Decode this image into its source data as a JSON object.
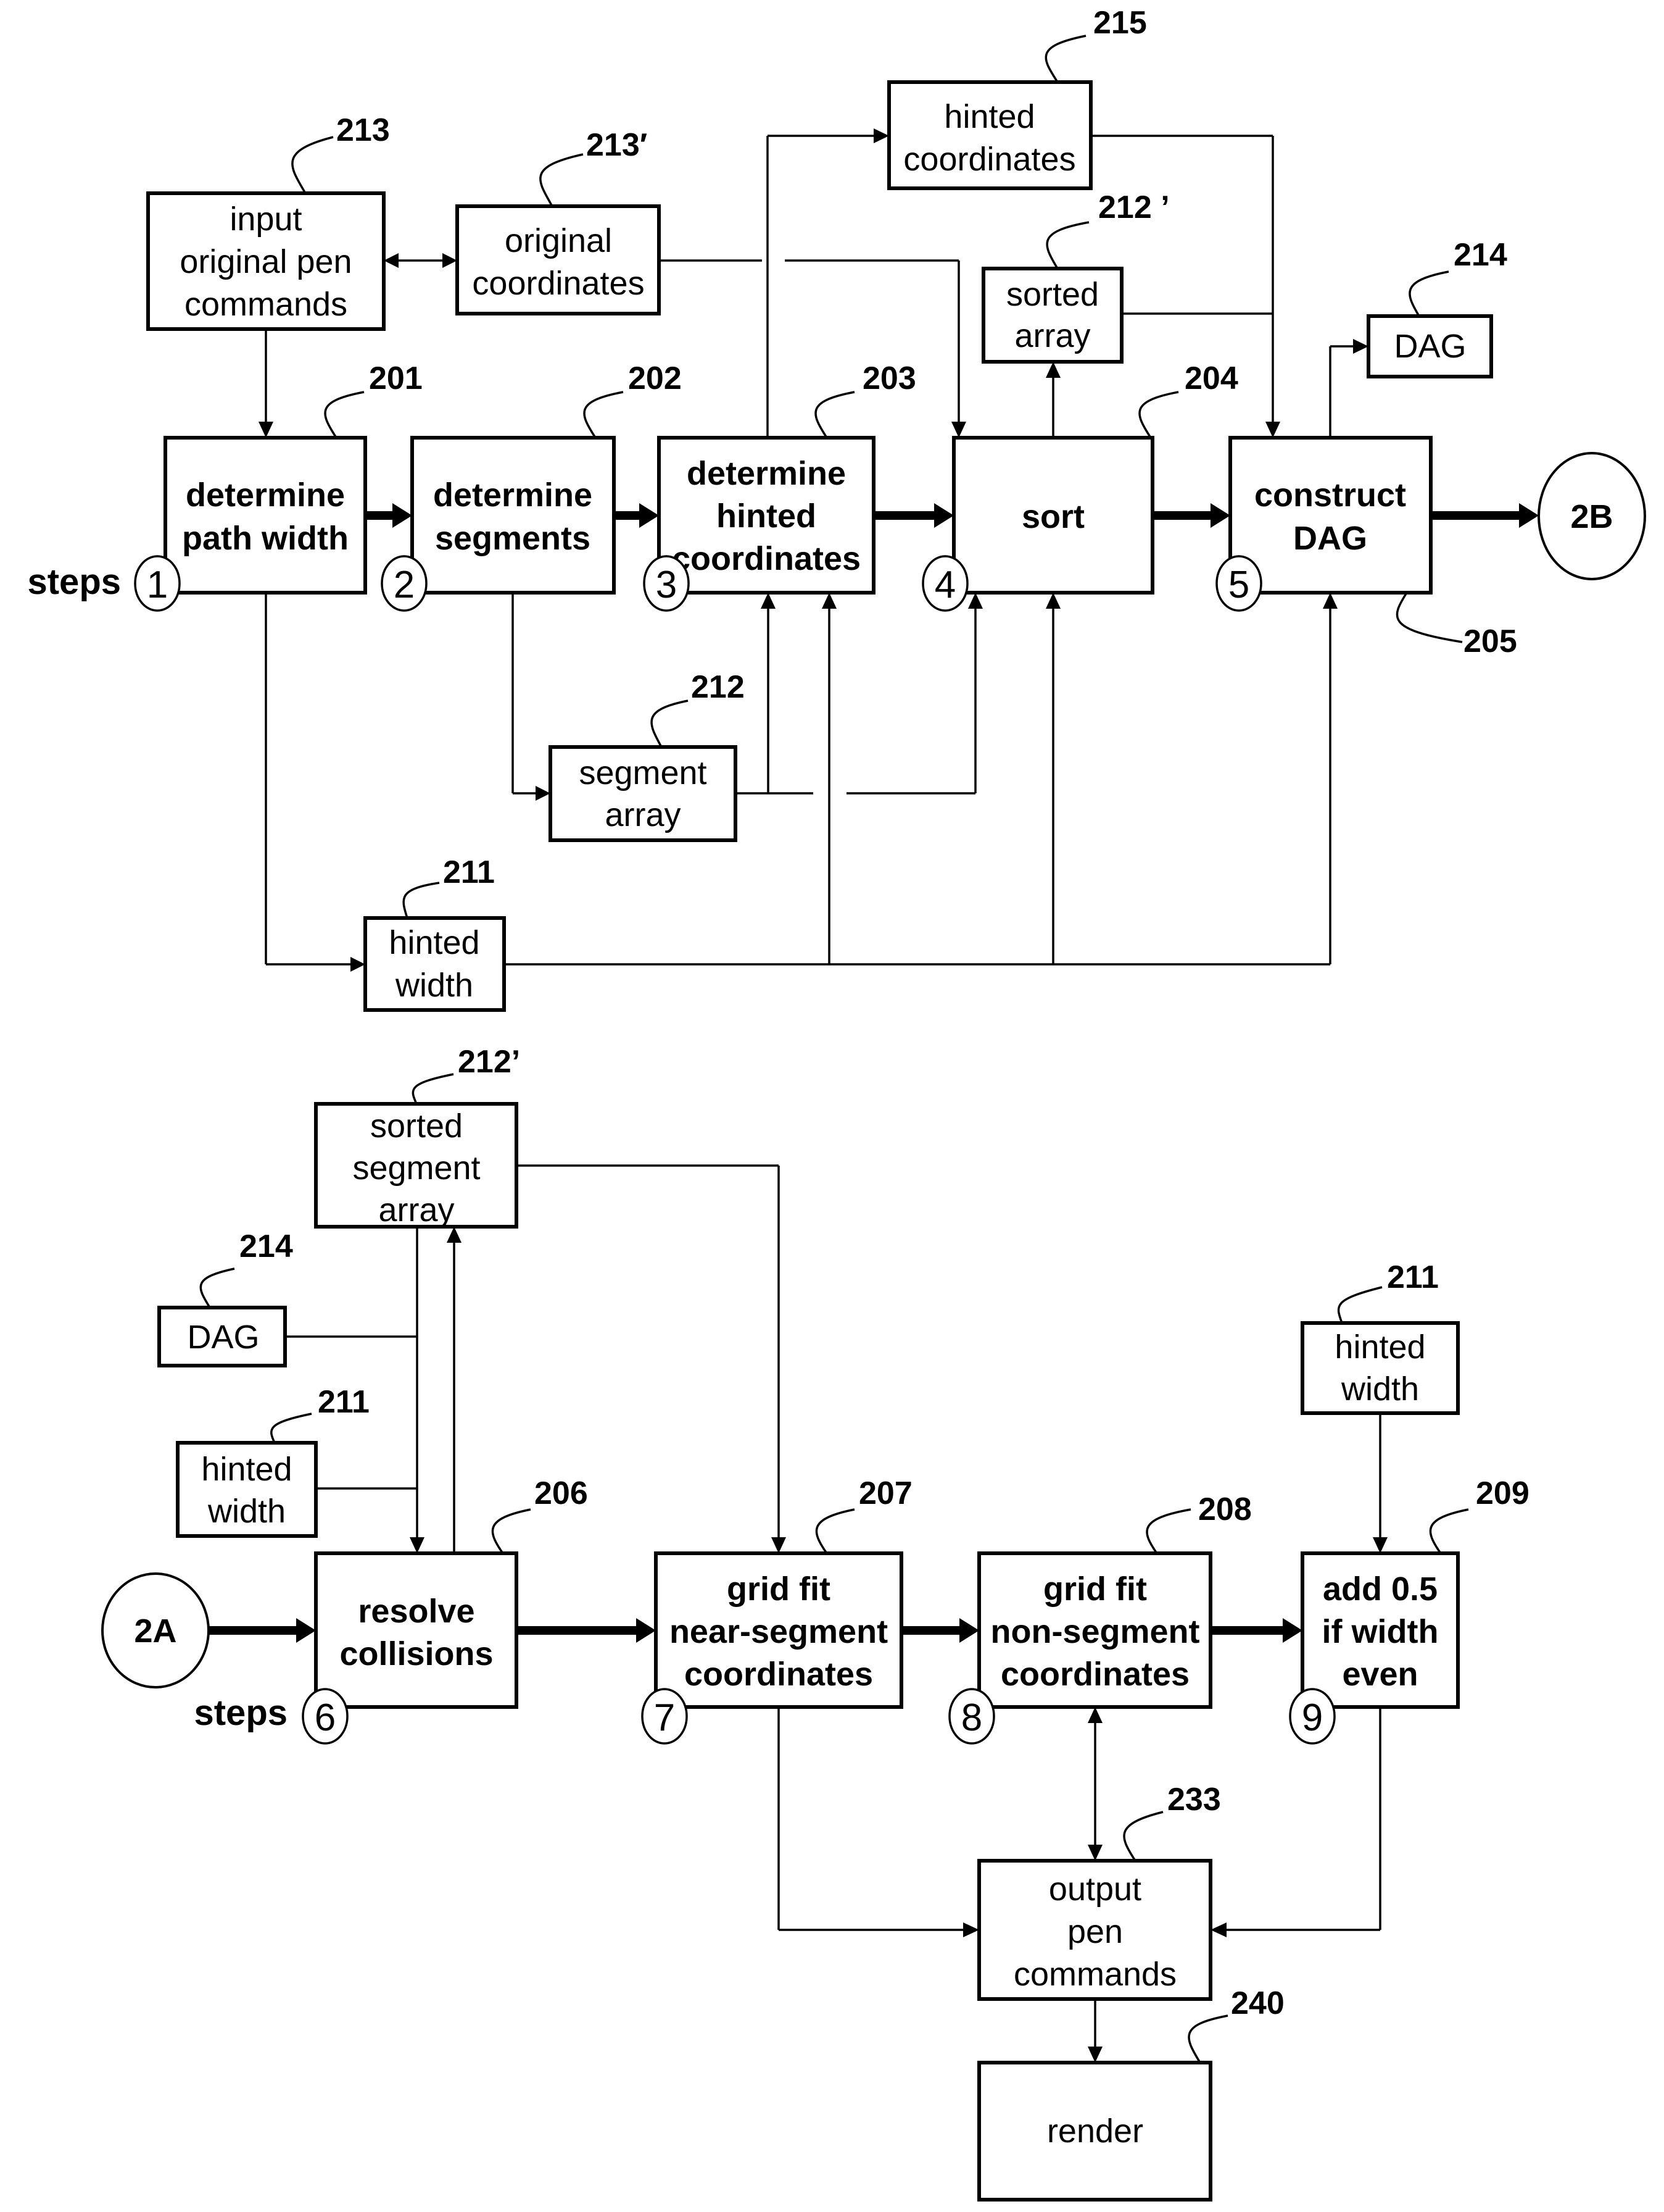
{
  "figure": {
    "part_a": {
      "steps_label": "steps",
      "process_boxes": [
        {
          "id": "201",
          "lines": [
            "determine",
            "path width"
          ],
          "step": "1"
        },
        {
          "id": "202",
          "lines": [
            "determine",
            "segments"
          ],
          "step": "2"
        },
        {
          "id": "203",
          "lines": [
            "determine",
            "hinted",
            "coordinates"
          ],
          "step": "3"
        },
        {
          "id": "204",
          "lines": [
            "sort"
          ],
          "step": "4"
        },
        {
          "id": "205",
          "lines": [
            "construct",
            "DAG"
          ],
          "step": "5"
        }
      ],
      "data_boxes": [
        {
          "id": "213",
          "lines": [
            "input",
            "original pen",
            "commands"
          ]
        },
        {
          "id": "213′",
          "lines": [
            "original",
            "coordinates"
          ]
        },
        {
          "id": "215",
          "lines": [
            "hinted",
            "coordinates"
          ]
        },
        {
          "id": "212 ’",
          "lines": [
            "sorted",
            "array"
          ]
        },
        {
          "id": "214",
          "lines": [
            "DAG"
          ]
        },
        {
          "id": "212",
          "lines": [
            "segment",
            "array"
          ]
        },
        {
          "id": "211",
          "lines": [
            "hinted",
            "width"
          ]
        }
      ],
      "connector_out": "2B"
    },
    "part_b": {
      "steps_label": "steps",
      "connector_in": "2A",
      "process_boxes": [
        {
          "id": "206",
          "lines": [
            "resolve",
            "collisions"
          ],
          "step": "6"
        },
        {
          "id": "207",
          "lines": [
            "grid fit",
            "near-segment",
            "coordinates"
          ],
          "step": "7"
        },
        {
          "id": "208",
          "lines": [
            "grid fit",
            "non-segment",
            "coordinates"
          ],
          "step": "8"
        },
        {
          "id": "209",
          "lines": [
            "add 0.5",
            "if width",
            "even"
          ],
          "step": "9"
        }
      ],
      "data_boxes": [
        {
          "id": "212’",
          "lines": [
            "sorted",
            "segment",
            "array"
          ]
        },
        {
          "id": "214",
          "lines": [
            "DAG"
          ]
        },
        {
          "id": "211",
          "lines": [
            "hinted",
            "width"
          ]
        },
        {
          "id": "211",
          "lines": [
            "hinted",
            "width"
          ]
        },
        {
          "id": "233",
          "lines": [
            "output",
            "pen",
            "commands"
          ]
        },
        {
          "id": "240",
          "lines": [
            "render"
          ]
        }
      ]
    }
  }
}
